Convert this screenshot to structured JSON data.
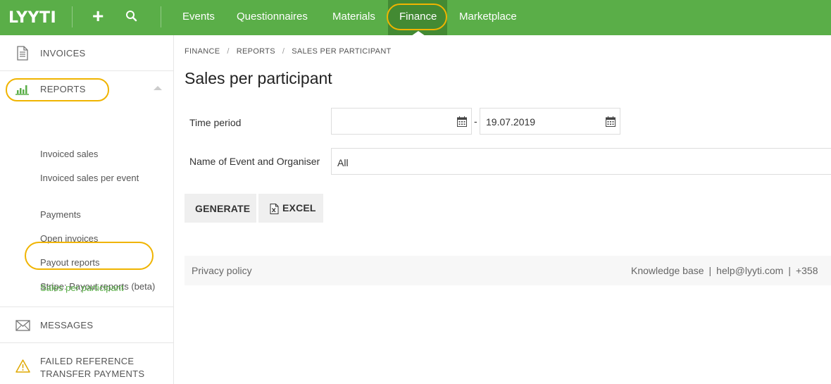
{
  "app": {
    "logo": "LYYTI",
    "plus_label": "+"
  },
  "topnav": {
    "items": [
      "Events",
      "Questionnaires",
      "Materials",
      "Finance",
      "Marketplace"
    ],
    "active": "Finance"
  },
  "sidebar": {
    "invoices": "INVOICES",
    "reports": "REPORTS",
    "report_items": [
      "Invoiced sales",
      "Invoiced sales per event",
      "Payments",
      "Open invoices",
      "Payout reports",
      "Stripe: Payout reports (beta)",
      "Sales per participant"
    ],
    "messages": "MESSAGES",
    "failed_line1": "FAILED REFERENCE",
    "failed_line2": "TRANSFER PAYMENTS"
  },
  "breadcrumb": [
    "FINANCE",
    "REPORTS",
    "SALES PER PARTICIPANT"
  ],
  "breadcrumb_sep": "/",
  "page_title": "Sales per participant",
  "form": {
    "time_period_label": "Time period",
    "date_from": "",
    "date_sep": "-",
    "date_to": "19.07.2019",
    "event_label": "Name of Event and Organiser",
    "event_value": "All"
  },
  "buttons": {
    "generate": "GENERATE",
    "excel": "EXCEL"
  },
  "footer": {
    "privacy": "Privacy policy",
    "knowledge": "Knowledge base",
    "email": "help@lyyti.com",
    "phone": "+358"
  },
  "colors": {
    "brand_green": "#5aae48",
    "active_green": "#438a33",
    "highlight": "#f0b400"
  }
}
